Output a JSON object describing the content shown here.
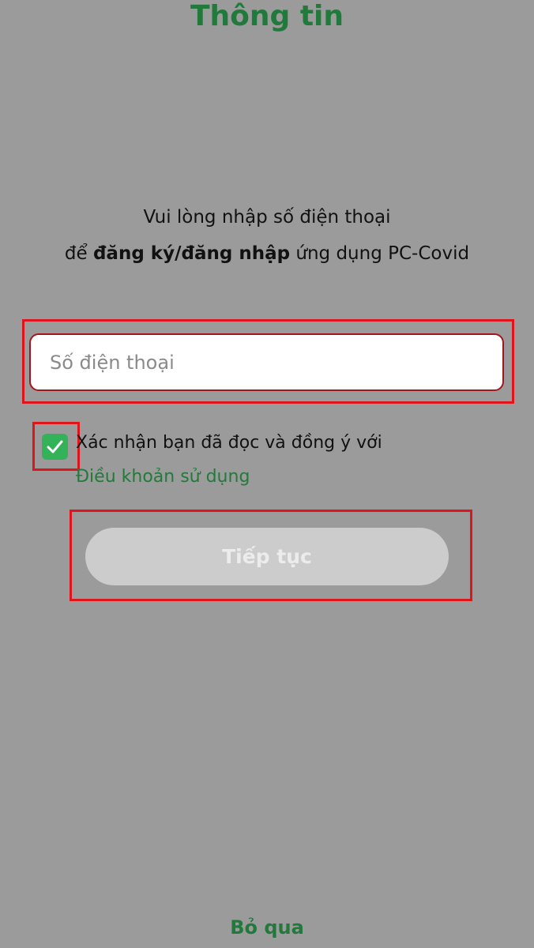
{
  "header": {
    "title": "Thông tin"
  },
  "instruction": {
    "line1": "Vui lòng nhập số điện thoại",
    "line2_prefix": "để ",
    "line2_bold": "đăng ký/đăng nhập",
    "line2_suffix": " ứng dụng PC-Covid"
  },
  "phone": {
    "placeholder": "Số điện thoại",
    "value": ""
  },
  "consent": {
    "checked": true,
    "text": "Xác nhận bạn đã đọc và đồng ý với",
    "link_label": "Điều khoản sử dụng"
  },
  "actions": {
    "continue_label": "Tiếp tục",
    "skip_label": "Bỏ qua"
  },
  "colors": {
    "background": "#9b9b9b",
    "brand_green": "#217a3b",
    "checkbox_green": "#34b25a",
    "highlight_red": "#e0141b",
    "disabled_button": "#cccccc"
  },
  "icons": {
    "checkbox": "checkmark-icon"
  }
}
